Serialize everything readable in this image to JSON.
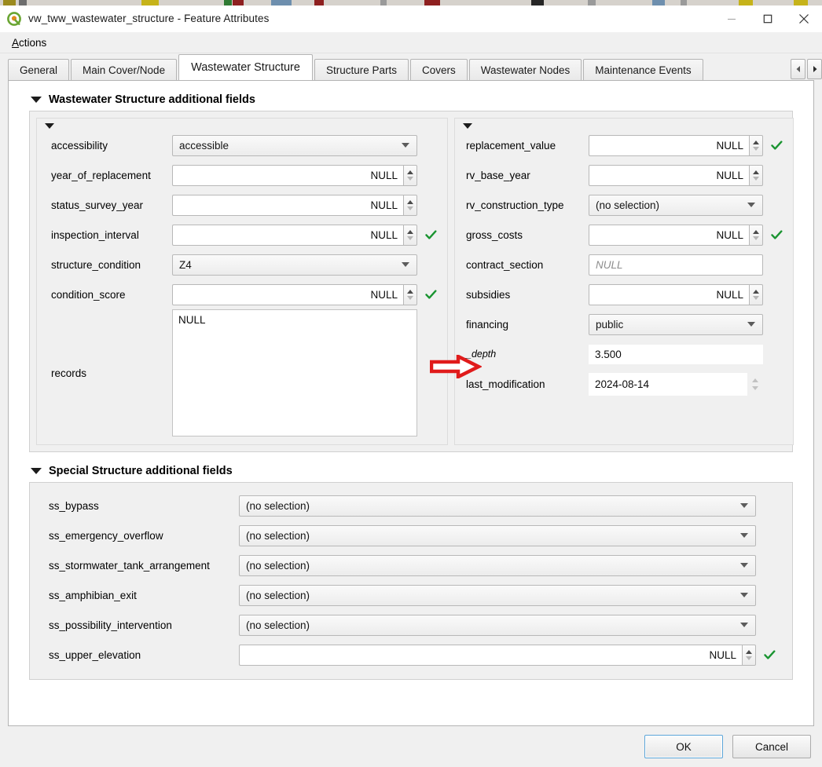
{
  "window": {
    "title": "vw_tww_wastewater_structure - Feature Attributes",
    "app_icon": "qgis-icon",
    "minimize_label": "Minimize",
    "maximize_label": "Maximize",
    "close_label": "Close"
  },
  "menubar": {
    "items": [
      {
        "label": "Actions",
        "mnemonic": "A"
      }
    ]
  },
  "tabs": {
    "items": [
      {
        "label": "General",
        "active": false
      },
      {
        "label": "Main Cover/Node",
        "active": false
      },
      {
        "label": "Wastewater Structure",
        "active": true
      },
      {
        "label": "Structure Parts",
        "active": false
      },
      {
        "label": "Covers",
        "active": false
      },
      {
        "label": "Wastewater Nodes",
        "active": false
      },
      {
        "label": "Maintenance Events",
        "active": false
      }
    ],
    "nav_prev": "tab-scroll-left",
    "nav_next": "tab-scroll-right"
  },
  "groups": {
    "wastewater_structure": {
      "title": "Wastewater Structure additional fields",
      "left_fields": [
        {
          "label": "accessibility",
          "type": "combo",
          "value": "accessible",
          "check": false
        },
        {
          "label": "year_of_replacement",
          "type": "spin",
          "value": "NULL",
          "check": false
        },
        {
          "label": "status_survey_year",
          "type": "spin",
          "value": "NULL",
          "check": false
        },
        {
          "label": "inspection_interval",
          "type": "spin",
          "value": "NULL",
          "check": true
        },
        {
          "label": "structure_condition",
          "type": "combo",
          "value": "Z4",
          "check": false
        },
        {
          "label": "condition_score",
          "type": "spin",
          "value": "NULL",
          "check": true
        }
      ],
      "records": {
        "label": "records",
        "value": "NULL"
      },
      "right_fields": [
        {
          "label": "replacement_value",
          "type": "spin",
          "value": "NULL",
          "check": true,
          "italic": false
        },
        {
          "label": "rv_base_year",
          "type": "spin",
          "value": "NULL",
          "check": false,
          "italic": false
        },
        {
          "label": "rv_construction_type",
          "type": "combo",
          "value": "(no selection)",
          "check": false,
          "italic": false
        },
        {
          "label": "gross_costs",
          "type": "spin",
          "value": "NULL",
          "check": true,
          "italic": false
        },
        {
          "label": "contract_section",
          "type": "text",
          "value": "",
          "placeholder": "NULL",
          "check": false,
          "italic": false
        },
        {
          "label": "subsidies",
          "type": "spin",
          "value": "NULL",
          "check": false,
          "italic": false
        },
        {
          "label": "financing",
          "type": "combo",
          "value": "public",
          "check": false,
          "italic": false
        },
        {
          "label": "_depth",
          "type": "flat",
          "value": "3.500",
          "check": false,
          "italic": true
        },
        {
          "label": "last_modification",
          "type": "datetime",
          "value": "2024-08-14",
          "check": false,
          "italic": false
        }
      ]
    },
    "special_structure": {
      "title": "Special Structure additional fields",
      "fields": [
        {
          "label": "ss_bypass",
          "type": "combo",
          "value": "(no selection)",
          "check": false
        },
        {
          "label": "ss_emergency_overflow",
          "type": "combo",
          "value": "(no selection)",
          "check": false
        },
        {
          "label": "ss_stormwater_tank_arrangement",
          "type": "combo",
          "value": "(no selection)",
          "check": false
        },
        {
          "label": "ss_amphibian_exit",
          "type": "combo",
          "value": "(no selection)",
          "check": false
        },
        {
          "label": "ss_possibility_intervention",
          "type": "combo",
          "value": "(no selection)",
          "check": false
        },
        {
          "label": "ss_upper_elevation",
          "type": "spin",
          "value": "NULL",
          "check": true
        }
      ]
    }
  },
  "buttons": {
    "ok": "OK",
    "cancel": "Cancel"
  },
  "annotation": {
    "type": "red-arrow",
    "points_at": "_depth",
    "color": "#e01b1b"
  },
  "colors": {
    "window_bg": "#f0f0f0",
    "field_bg": "#ffffff",
    "border": "#b8b8b8",
    "valid_check": "#1a9431",
    "accent_focus": "#5ba5d8",
    "annotation_red": "#e01b1b"
  }
}
